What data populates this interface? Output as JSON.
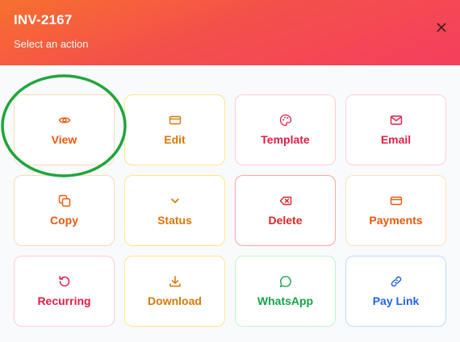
{
  "header": {
    "title": "INV-2167",
    "subtitle": "Select an action"
  },
  "actions": [
    {
      "label": "View",
      "icon": "eye-icon",
      "color": "#ea580c",
      "border": "#fcd9b6"
    },
    {
      "label": "Edit",
      "icon": "card-icon",
      "color": "#d97706",
      "border": "#fde68a"
    },
    {
      "label": "Template",
      "icon": "palette-icon",
      "color": "#e11d48",
      "border": "#fecdd3"
    },
    {
      "label": "Email",
      "icon": "mail-icon",
      "color": "#e11d48",
      "border": "#fecdd3"
    },
    {
      "label": "Copy",
      "icon": "copy-icon",
      "color": "#ea580c",
      "border": "#fcd9b6"
    },
    {
      "label": "Status",
      "icon": "chevron-down-icon",
      "color": "#d97706",
      "border": "#fde68a"
    },
    {
      "label": "Delete",
      "icon": "backspace-icon",
      "color": "#dc2626",
      "border": "#fca5a5"
    },
    {
      "label": "Payments",
      "icon": "card-icon",
      "color": "#ea580c",
      "border": "#fde2b8"
    },
    {
      "label": "Recurring",
      "icon": "refresh-icon",
      "color": "#e11d48",
      "border": "#fecdd3"
    },
    {
      "label": "Download",
      "icon": "download-icon",
      "color": "#d97706",
      "border": "#fde68a"
    },
    {
      "label": "WhatsApp",
      "icon": "chat-bubble-icon",
      "color": "#16a34a",
      "border": "#bbf7d0"
    },
    {
      "label": "Pay Link",
      "icon": "link-icon",
      "color": "#2563eb",
      "border": "#bfdbfe"
    }
  ],
  "annotation": {
    "color": "#1fa53c",
    "target": "View"
  }
}
